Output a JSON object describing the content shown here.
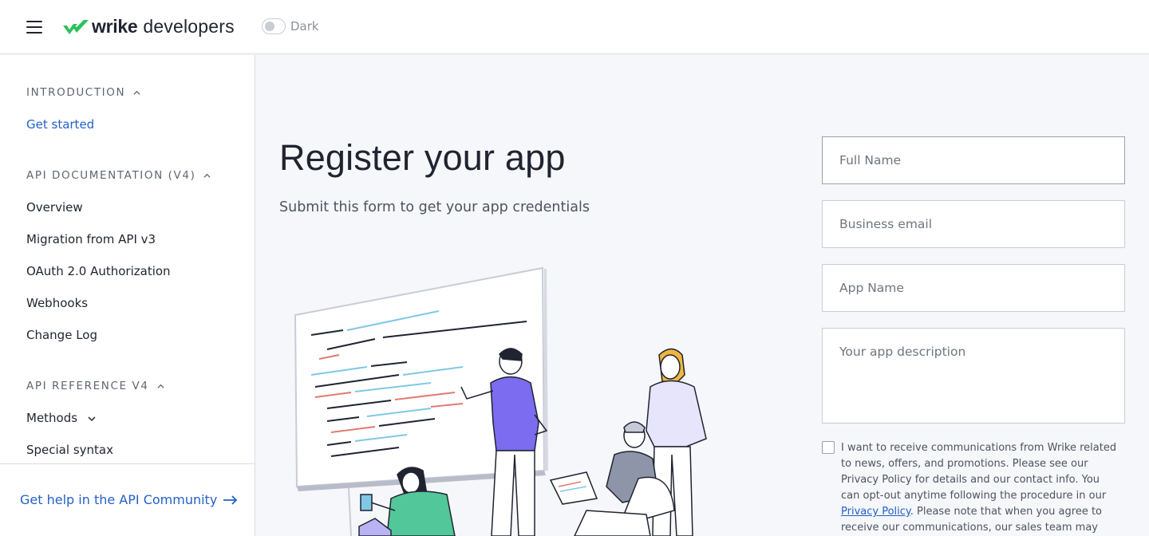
{
  "header": {
    "logo_brand": "wrike",
    "logo_product": "developers",
    "theme_toggle_label": "Dark",
    "brand_color": "#2ac15a"
  },
  "sidebar": {
    "sections": [
      {
        "title": "INTRODUCTION",
        "expanded": true,
        "items": [
          {
            "label": "Get started",
            "active": true
          }
        ]
      },
      {
        "title": "API DOCUMENTATION (V4)",
        "expanded": true,
        "items": [
          {
            "label": "Overview"
          },
          {
            "label": "Migration from API v3"
          },
          {
            "label": "OAuth 2.0 Authorization"
          },
          {
            "label": "Webhooks"
          },
          {
            "label": "Change Log"
          }
        ]
      },
      {
        "title": "API REFERENCE V4",
        "expanded": true,
        "items": [
          {
            "label": "Methods",
            "has_submenu": true
          },
          {
            "label": "Special syntax"
          }
        ]
      }
    ],
    "footer_link": "Get help in the API Community"
  },
  "main": {
    "title": "Register your app",
    "subtitle": "Submit this form to get your app credentials"
  },
  "form": {
    "full_name_placeholder": "Full Name",
    "email_placeholder": "Business email",
    "app_name_placeholder": "App Name",
    "description_placeholder": "Your app description",
    "consent_text_before": "I want to receive communications from Wrike related to news, offers, and promotions. Please see our Privacy Policy for details and our contact info. You can opt-out anytime following the procedure in our ",
    "consent_link": "Privacy Policy",
    "consent_text_after": ". Please note that when you agree to receive our communications, our sales team may use the data you"
  },
  "colors": {
    "link": "#2460c8",
    "accent_purple": "#7b6cf0",
    "accent_green": "#52c79a",
    "accent_yellow": "#f2b640"
  }
}
